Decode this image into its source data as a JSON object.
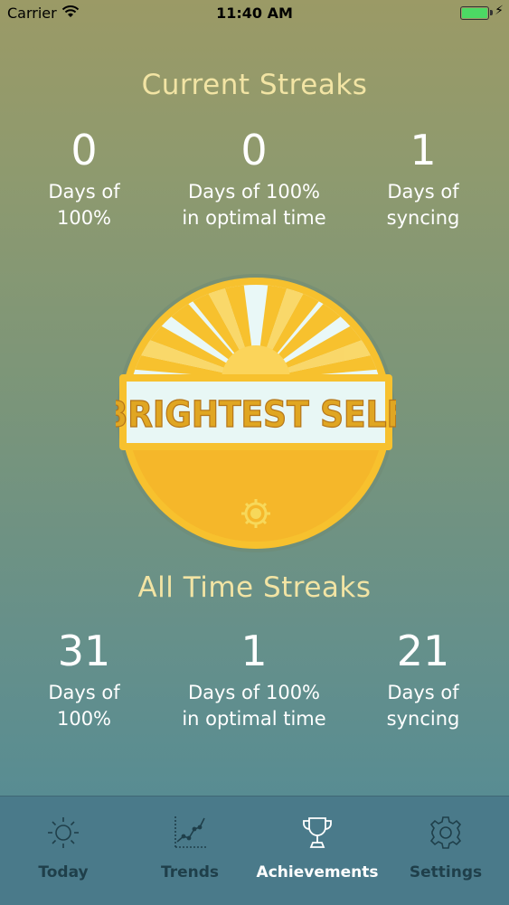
{
  "status_bar": {
    "carrier": "Carrier",
    "time": "11:40 AM"
  },
  "current_streaks": {
    "title": "Current Streaks",
    "stats": [
      {
        "value": "0",
        "label": "Days of\n100%"
      },
      {
        "value": "0",
        "label": "Days of 100%\nin optimal time"
      },
      {
        "value": "1",
        "label": "Days of\nsyncing"
      }
    ]
  },
  "badge": {
    "text": "BRIGHTEST SELF",
    "icon": "sun-badge"
  },
  "all_time_streaks": {
    "title": "All Time Streaks",
    "stats": [
      {
        "value": "31",
        "label": "Days of\n100%"
      },
      {
        "value": "1",
        "label": "Days of 100%\nin optimal time"
      },
      {
        "value": "21",
        "label": "Days of\nsyncing"
      }
    ]
  },
  "tab_bar": {
    "tabs": [
      {
        "label": "Today",
        "icon": "sun-icon"
      },
      {
        "label": "Trends",
        "icon": "chart-icon"
      },
      {
        "label": "Achievements",
        "icon": "trophy-icon",
        "active": true
      },
      {
        "label": "Settings",
        "icon": "gear-icon"
      }
    ]
  },
  "colors": {
    "title": "#f2e4a4",
    "badge_yellow": "#f7c12e",
    "badge_banner": "#e8f7f5",
    "tab_inactive": "#1f3f4a"
  }
}
